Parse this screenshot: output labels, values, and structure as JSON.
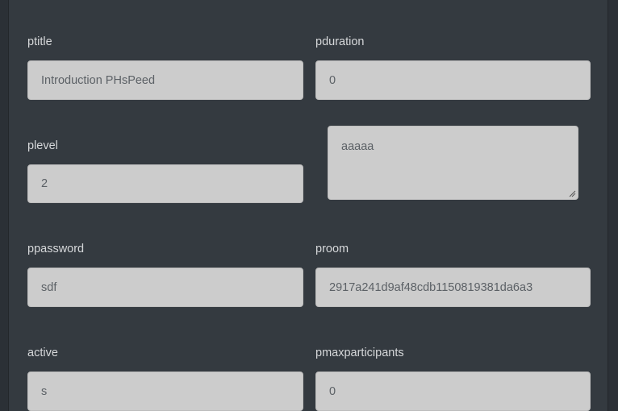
{
  "form": {
    "ptitle": {
      "label": "ptitle",
      "value": "Introduction PHsPeed"
    },
    "pduration": {
      "label": "pduration",
      "value": "0"
    },
    "plevel": {
      "label": "plevel",
      "value": "2"
    },
    "description": {
      "value": "aaaaa"
    },
    "ppassword": {
      "label": "ppassword",
      "value": "sdf"
    },
    "proom": {
      "label": "proom",
      "value": "2917a241d9af48cdb1150819381da6a3"
    },
    "active": {
      "label": "active",
      "value": "s"
    },
    "pmaxparticipants": {
      "label": "pmaxparticipants",
      "value": "0"
    }
  }
}
